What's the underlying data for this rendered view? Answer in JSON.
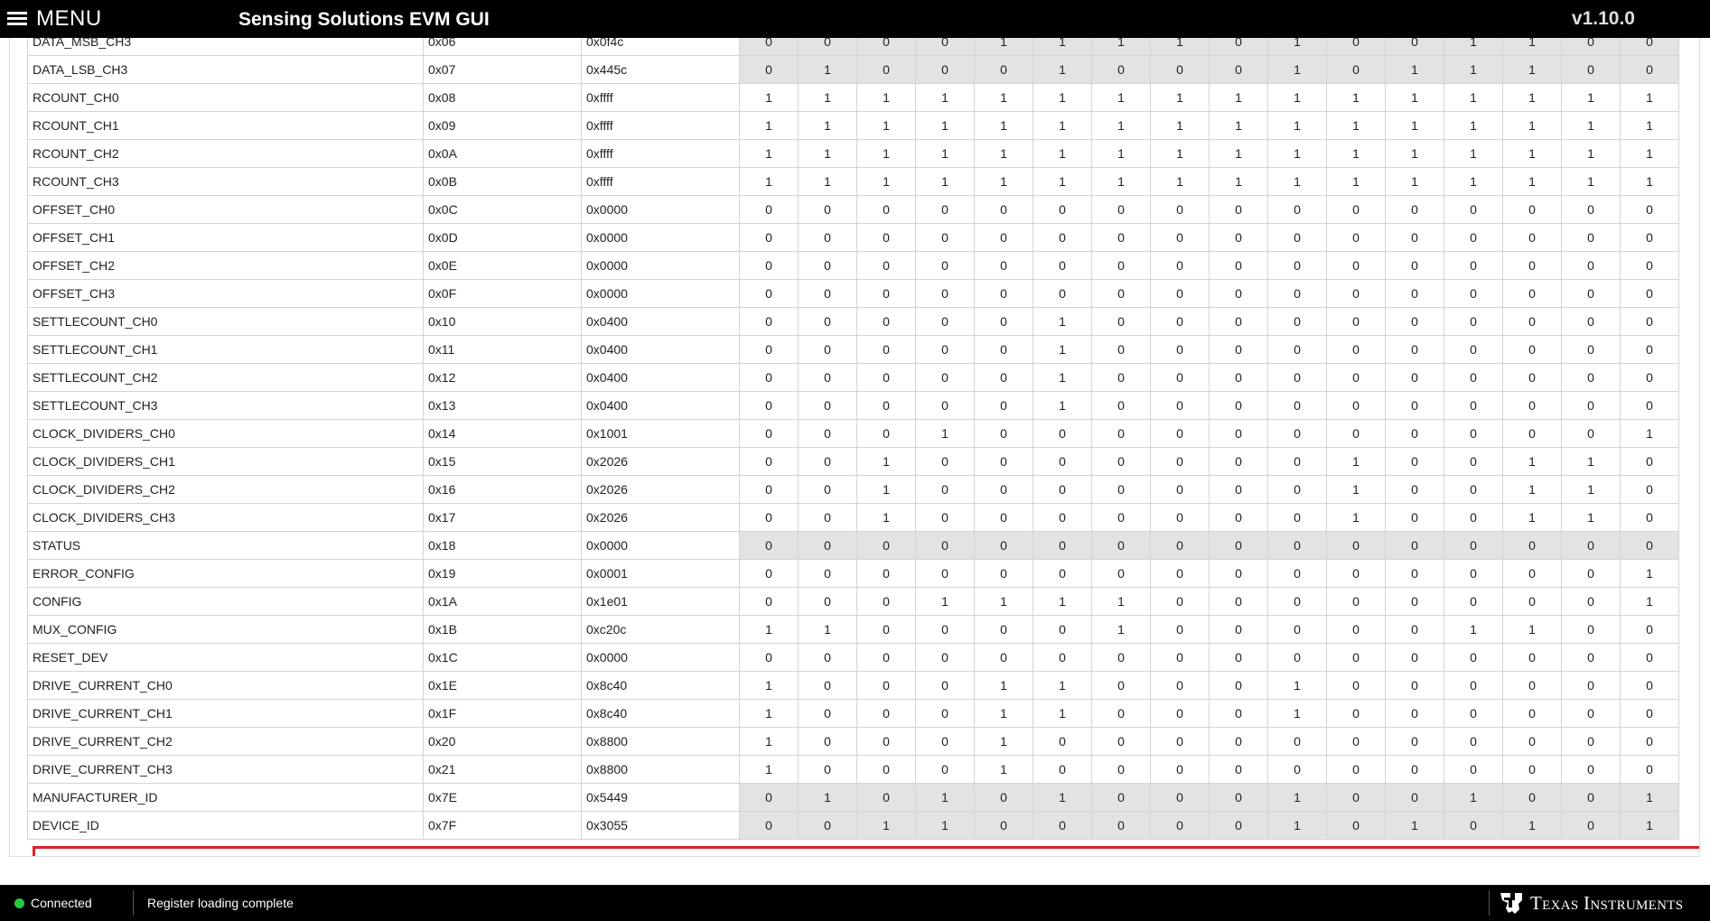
{
  "header": {
    "menu_label": "MENU",
    "app_title": "Sensing Solutions EVM GUI",
    "version": "v1.10.0"
  },
  "registers": [
    {
      "name": "DATA_MSB_CH3",
      "addr": "0x06",
      "value": "0x0f4c",
      "bits": [
        "0",
        "0",
        "0",
        "0",
        "1",
        "1",
        "1",
        "1",
        "0",
        "1",
        "0",
        "0",
        "1",
        "1",
        "0",
        "0"
      ],
      "readonly": true
    },
    {
      "name": "DATA_LSB_CH3",
      "addr": "0x07",
      "value": "0x445c",
      "bits": [
        "0",
        "1",
        "0",
        "0",
        "0",
        "1",
        "0",
        "0",
        "0",
        "1",
        "0",
        "1",
        "1",
        "1",
        "0",
        "0"
      ],
      "readonly": true
    },
    {
      "name": "RCOUNT_CH0",
      "addr": "0x08",
      "value": "0xffff",
      "bits": [
        "1",
        "1",
        "1",
        "1",
        "1",
        "1",
        "1",
        "1",
        "1",
        "1",
        "1",
        "1",
        "1",
        "1",
        "1",
        "1"
      ],
      "readonly": false
    },
    {
      "name": "RCOUNT_CH1",
      "addr": "0x09",
      "value": "0xffff",
      "bits": [
        "1",
        "1",
        "1",
        "1",
        "1",
        "1",
        "1",
        "1",
        "1",
        "1",
        "1",
        "1",
        "1",
        "1",
        "1",
        "1"
      ],
      "readonly": false
    },
    {
      "name": "RCOUNT_CH2",
      "addr": "0x0A",
      "value": "0xffff",
      "bits": [
        "1",
        "1",
        "1",
        "1",
        "1",
        "1",
        "1",
        "1",
        "1",
        "1",
        "1",
        "1",
        "1",
        "1",
        "1",
        "1"
      ],
      "readonly": false
    },
    {
      "name": "RCOUNT_CH3",
      "addr": "0x0B",
      "value": "0xffff",
      "bits": [
        "1",
        "1",
        "1",
        "1",
        "1",
        "1",
        "1",
        "1",
        "1",
        "1",
        "1",
        "1",
        "1",
        "1",
        "1",
        "1"
      ],
      "readonly": false
    },
    {
      "name": "OFFSET_CH0",
      "addr": "0x0C",
      "value": "0x0000",
      "bits": [
        "0",
        "0",
        "0",
        "0",
        "0",
        "0",
        "0",
        "0",
        "0",
        "0",
        "0",
        "0",
        "0",
        "0",
        "0",
        "0"
      ],
      "readonly": false
    },
    {
      "name": "OFFSET_CH1",
      "addr": "0x0D",
      "value": "0x0000",
      "bits": [
        "0",
        "0",
        "0",
        "0",
        "0",
        "0",
        "0",
        "0",
        "0",
        "0",
        "0",
        "0",
        "0",
        "0",
        "0",
        "0"
      ],
      "readonly": false
    },
    {
      "name": "OFFSET_CH2",
      "addr": "0x0E",
      "value": "0x0000",
      "bits": [
        "0",
        "0",
        "0",
        "0",
        "0",
        "0",
        "0",
        "0",
        "0",
        "0",
        "0",
        "0",
        "0",
        "0",
        "0",
        "0"
      ],
      "readonly": false
    },
    {
      "name": "OFFSET_CH3",
      "addr": "0x0F",
      "value": "0x0000",
      "bits": [
        "0",
        "0",
        "0",
        "0",
        "0",
        "0",
        "0",
        "0",
        "0",
        "0",
        "0",
        "0",
        "0",
        "0",
        "0",
        "0"
      ],
      "readonly": false
    },
    {
      "name": "SETTLECOUNT_CH0",
      "addr": "0x10",
      "value": "0x0400",
      "bits": [
        "0",
        "0",
        "0",
        "0",
        "0",
        "1",
        "0",
        "0",
        "0",
        "0",
        "0",
        "0",
        "0",
        "0",
        "0",
        "0"
      ],
      "readonly": false
    },
    {
      "name": "SETTLECOUNT_CH1",
      "addr": "0x11",
      "value": "0x0400",
      "bits": [
        "0",
        "0",
        "0",
        "0",
        "0",
        "1",
        "0",
        "0",
        "0",
        "0",
        "0",
        "0",
        "0",
        "0",
        "0",
        "0"
      ],
      "readonly": false
    },
    {
      "name": "SETTLECOUNT_CH2",
      "addr": "0x12",
      "value": "0x0400",
      "bits": [
        "0",
        "0",
        "0",
        "0",
        "0",
        "1",
        "0",
        "0",
        "0",
        "0",
        "0",
        "0",
        "0",
        "0",
        "0",
        "0"
      ],
      "readonly": false
    },
    {
      "name": "SETTLECOUNT_CH3",
      "addr": "0x13",
      "value": "0x0400",
      "bits": [
        "0",
        "0",
        "0",
        "0",
        "0",
        "1",
        "0",
        "0",
        "0",
        "0",
        "0",
        "0",
        "0",
        "0",
        "0",
        "0"
      ],
      "readonly": false
    },
    {
      "name": "CLOCK_DIVIDERS_CH0",
      "addr": "0x14",
      "value": "0x1001",
      "bits": [
        "0",
        "0",
        "0",
        "1",
        "0",
        "0",
        "0",
        "0",
        "0",
        "0",
        "0",
        "0",
        "0",
        "0",
        "0",
        "1"
      ],
      "readonly": false
    },
    {
      "name": "CLOCK_DIVIDERS_CH1",
      "addr": "0x15",
      "value": "0x2026",
      "bits": [
        "0",
        "0",
        "1",
        "0",
        "0",
        "0",
        "0",
        "0",
        "0",
        "0",
        "1",
        "0",
        "0",
        "1",
        "1",
        "0"
      ],
      "readonly": false
    },
    {
      "name": "CLOCK_DIVIDERS_CH2",
      "addr": "0x16",
      "value": "0x2026",
      "bits": [
        "0",
        "0",
        "1",
        "0",
        "0",
        "0",
        "0",
        "0",
        "0",
        "0",
        "1",
        "0",
        "0",
        "1",
        "1",
        "0"
      ],
      "readonly": false
    },
    {
      "name": "CLOCK_DIVIDERS_CH3",
      "addr": "0x17",
      "value": "0x2026",
      "bits": [
        "0",
        "0",
        "1",
        "0",
        "0",
        "0",
        "0",
        "0",
        "0",
        "0",
        "1",
        "0",
        "0",
        "1",
        "1",
        "0"
      ],
      "readonly": false
    },
    {
      "name": "STATUS",
      "addr": "0x18",
      "value": "0x0000",
      "bits": [
        "0",
        "0",
        "0",
        "0",
        "0",
        "0",
        "0",
        "0",
        "0",
        "0",
        "0",
        "0",
        "0",
        "0",
        "0",
        "0"
      ],
      "readonly": true
    },
    {
      "name": "ERROR_CONFIG",
      "addr": "0x19",
      "value": "0x0001",
      "bits": [
        "0",
        "0",
        "0",
        "0",
        "0",
        "0",
        "0",
        "0",
        "0",
        "0",
        "0",
        "0",
        "0",
        "0",
        "0",
        "1"
      ],
      "readonly": false
    },
    {
      "name": "CONFIG",
      "addr": "0x1A",
      "value": "0x1e01",
      "bits": [
        "0",
        "0",
        "0",
        "1",
        "1",
        "1",
        "1",
        "0",
        "0",
        "0",
        "0",
        "0",
        "0",
        "0",
        "0",
        "1"
      ],
      "readonly": false
    },
    {
      "name": "MUX_CONFIG",
      "addr": "0x1B",
      "value": "0xc20c",
      "bits": [
        "1",
        "1",
        "0",
        "0",
        "0",
        "0",
        "1",
        "0",
        "0",
        "0",
        "0",
        "0",
        "1",
        "1",
        "0",
        "0"
      ],
      "readonly": false
    },
    {
      "name": "RESET_DEV",
      "addr": "0x1C",
      "value": "0x0000",
      "bits": [
        "0",
        "0",
        "0",
        "0",
        "0",
        "0",
        "0",
        "0",
        "0",
        "0",
        "0",
        "0",
        "0",
        "0",
        "0",
        "0"
      ],
      "readonly": false
    },
    {
      "name": "DRIVE_CURRENT_CH0",
      "addr": "0x1E",
      "value": "0x8c40",
      "bits": [
        "1",
        "0",
        "0",
        "0",
        "1",
        "1",
        "0",
        "0",
        "0",
        "1",
        "0",
        "0",
        "0",
        "0",
        "0",
        "0"
      ],
      "readonly": false
    },
    {
      "name": "DRIVE_CURRENT_CH1",
      "addr": "0x1F",
      "value": "0x8c40",
      "bits": [
        "1",
        "0",
        "0",
        "0",
        "1",
        "1",
        "0",
        "0",
        "0",
        "1",
        "0",
        "0",
        "0",
        "0",
        "0",
        "0"
      ],
      "readonly": false
    },
    {
      "name": "DRIVE_CURRENT_CH2",
      "addr": "0x20",
      "value": "0x8800",
      "bits": [
        "1",
        "0",
        "0",
        "0",
        "1",
        "0",
        "0",
        "0",
        "0",
        "0",
        "0",
        "0",
        "0",
        "0",
        "0",
        "0"
      ],
      "readonly": false
    },
    {
      "name": "DRIVE_CURRENT_CH3",
      "addr": "0x21",
      "value": "0x8800",
      "bits": [
        "1",
        "0",
        "0",
        "0",
        "1",
        "0",
        "0",
        "0",
        "0",
        "0",
        "0",
        "0",
        "0",
        "0",
        "0",
        "0"
      ],
      "readonly": false
    },
    {
      "name": "MANUFACTURER_ID",
      "addr": "0x7E",
      "value": "0x5449",
      "bits": [
        "0",
        "1",
        "0",
        "1",
        "0",
        "1",
        "0",
        "0",
        "0",
        "1",
        "0",
        "0",
        "1",
        "0",
        "0",
        "1"
      ],
      "readonly": true
    },
    {
      "name": "DEVICE_ID",
      "addr": "0x7F",
      "value": "0x3055",
      "bits": [
        "0",
        "0",
        "1",
        "1",
        "0",
        "0",
        "0",
        "0",
        "0",
        "1",
        "0",
        "1",
        "0",
        "1",
        "0",
        "1"
      ],
      "readonly": true,
      "highlighted": true
    }
  ],
  "status": {
    "connection": "Connected",
    "message": "Register loading complete",
    "brand": "Texas Instruments"
  },
  "colors": {
    "topbar": "#000000",
    "readonly_bg": "#e3e3e3",
    "highlight_border": "#e0202a",
    "connected_dot": "#27c93f"
  }
}
